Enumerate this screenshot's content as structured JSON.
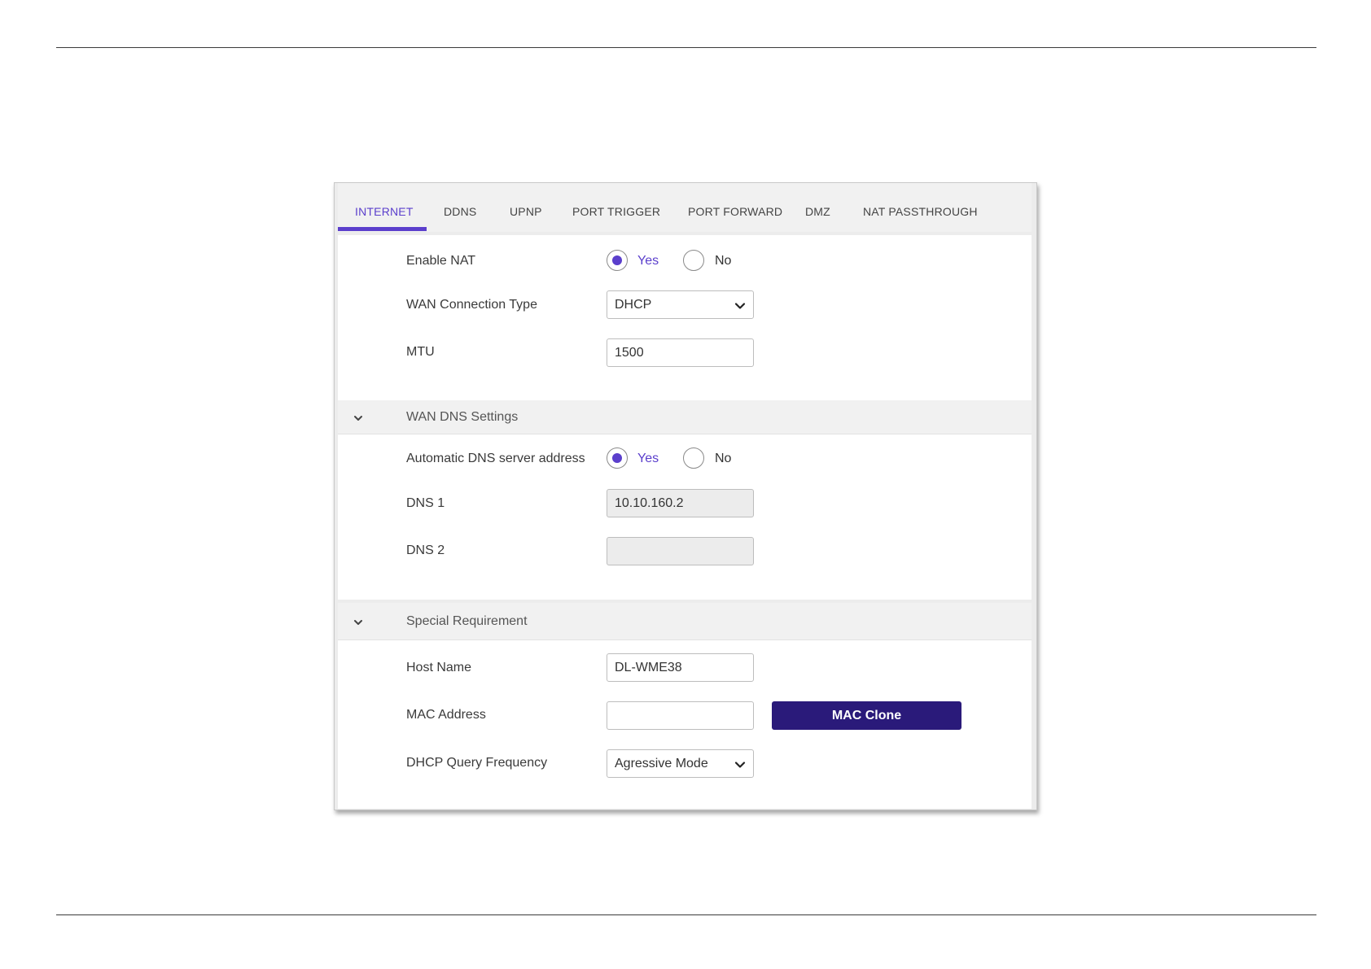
{
  "tabs": [
    {
      "label": "INTERNET"
    },
    {
      "label": "DDNS"
    },
    {
      "label": "UPNP"
    },
    {
      "label": "PORT TRIGGER"
    },
    {
      "label": "PORT FORWARD"
    },
    {
      "label": "DMZ"
    },
    {
      "label": "NAT PASSTHROUGH"
    }
  ],
  "active_tab": "INTERNET",
  "basic": {
    "enable_nat": {
      "label": "Enable NAT",
      "yes": "Yes",
      "no": "No",
      "selected": "Yes"
    },
    "wan_type": {
      "label": "WAN Connection Type",
      "value": "DHCP"
    },
    "mtu": {
      "label": "MTU",
      "value": "1500"
    }
  },
  "dns": {
    "header": "WAN DNS Settings",
    "auto_dns": {
      "label": "Automatic DNS server address",
      "yes": "Yes",
      "no": "No",
      "selected": "Yes"
    },
    "dns1": {
      "label": "DNS 1",
      "value": "10.10.160.2"
    },
    "dns2": {
      "label": "DNS 2",
      "value": ""
    }
  },
  "special": {
    "header": "Special Requirement",
    "host_name": {
      "label": "Host Name",
      "value": "DL-WME38"
    },
    "mac_address": {
      "label": "MAC Address",
      "value": ""
    },
    "mac_clone_button": "MAC Clone",
    "dhcp_query": {
      "label": "DHCP Query Frequency",
      "value": "Agressive Mode"
    }
  },
  "colors": {
    "accent": "#5b3fcc",
    "button": "#2a1a7a"
  },
  "icons": {
    "section_toggle": "chevron-down-icon",
    "select_arrow": "chevron-down-icon"
  }
}
